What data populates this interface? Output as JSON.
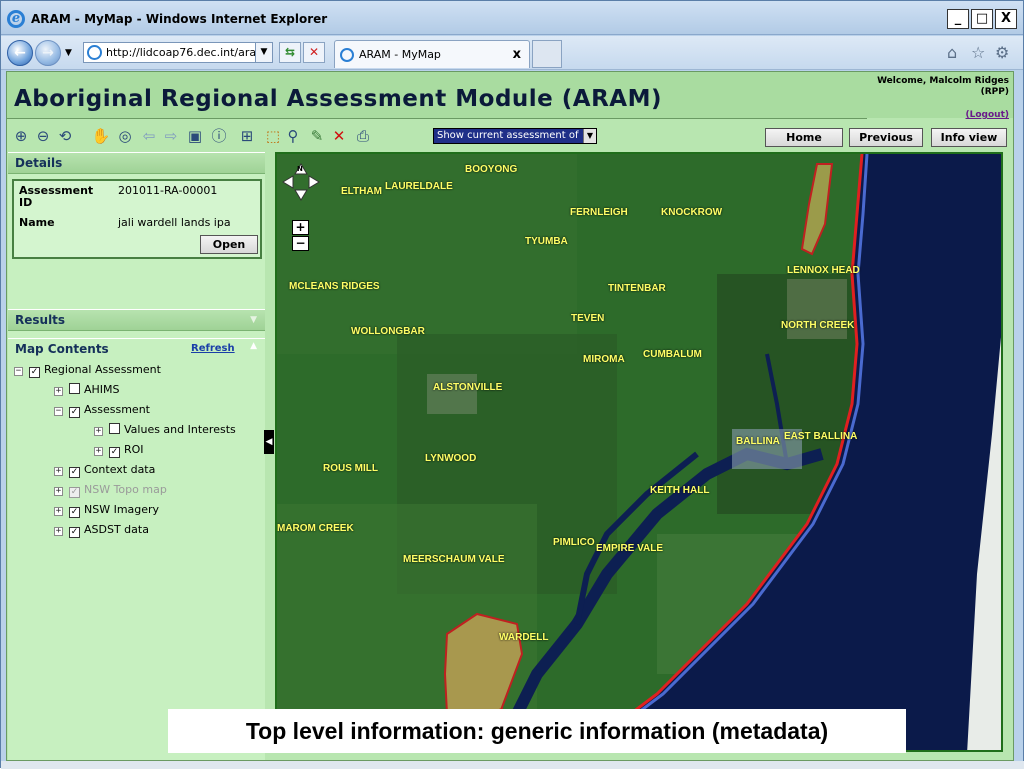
{
  "window": {
    "title": "ARAM - MyMap - Windows Internet Explorer",
    "min": "_",
    "max": "□",
    "close": "X"
  },
  "browser": {
    "address": "http://lidcoap76.dec.int/ara",
    "tab_title": "ARAM - MyMap",
    "tab_close": "x"
  },
  "app": {
    "title": "Aboriginal Regional Assessment Module (ARAM)",
    "welcome_line1": "Welcome, Malcolm Ridges",
    "welcome_line2": "(RPP)",
    "logout": "(Logout)"
  },
  "toolbar": {
    "select_value": "Show current assessment of",
    "home": "Home",
    "previous": "Previous",
    "info_view": "Info view"
  },
  "details": {
    "header": "Details",
    "assessment_label": "Assessment ID",
    "assessment_value": "201011-RA-00001",
    "name_label": "Name",
    "name_value": "jali wardell lands ipa",
    "open": "Open"
  },
  "results": {
    "header": "Results"
  },
  "map_contents": {
    "header": "Map Contents",
    "refresh": "Refresh",
    "tree": [
      {
        "label": "Regional Assessment",
        "expander": "−",
        "checked": "✓",
        "level": 0,
        "muted": false
      },
      {
        "label": "AHIMS",
        "expander": "+",
        "checked": "",
        "level": 1,
        "muted": false
      },
      {
        "label": "Assessment",
        "expander": "−",
        "checked": "✓",
        "level": 1,
        "muted": false
      },
      {
        "label": "Values and Interests",
        "expander": "+",
        "checked": "",
        "level": 2,
        "muted": false
      },
      {
        "label": "ROI",
        "expander": "+",
        "checked": "✓",
        "level": 2,
        "muted": false
      },
      {
        "label": "Context data",
        "expander": "+",
        "checked": "✓",
        "level": 1,
        "muted": false
      },
      {
        "label": "NSW Topo map",
        "expander": "+",
        "checked": "✓",
        "level": 1,
        "muted": true
      },
      {
        "label": "NSW Imagery",
        "expander": "+",
        "checked": "✓",
        "level": 1,
        "muted": false
      },
      {
        "label": "ASDST data",
        "expander": "+",
        "checked": "✓",
        "level": 1,
        "muted": false
      }
    ]
  },
  "map": {
    "zoom_in": "+",
    "zoom_out": "−",
    "north": "N",
    "places": [
      "BOOYONG",
      "ELTHAM",
      "LAURELDALE",
      "FERNLEIGH",
      "KNOCKROW",
      "TYUMBA",
      "LENNOX HEAD",
      "MCLEANS RIDGES",
      "TINTENBAR",
      "TEVEN",
      "NORTH CREEK",
      "WOLLONGBAR",
      "MIROMA",
      "CUMBALUM",
      "ALSTONVILLE",
      "BALLINA",
      "EAST BALLINA",
      "LYNWOOD",
      "ROUS MILL",
      "KEITH HALL",
      "MAROM CREEK",
      "PIMLICO",
      "EMPIRE VALE",
      "MEERSCHAUM VALE",
      "WARDELL"
    ]
  },
  "caption": "Top level information: generic information (metadata)",
  "colors": {
    "app_bg": "#b8e6b0",
    "header_bg": "#a9dca0",
    "ocean": "#0b1a4a",
    "land": "#2d6b2a",
    "place_label": "#ffff66",
    "coast_line": "#e02020"
  }
}
